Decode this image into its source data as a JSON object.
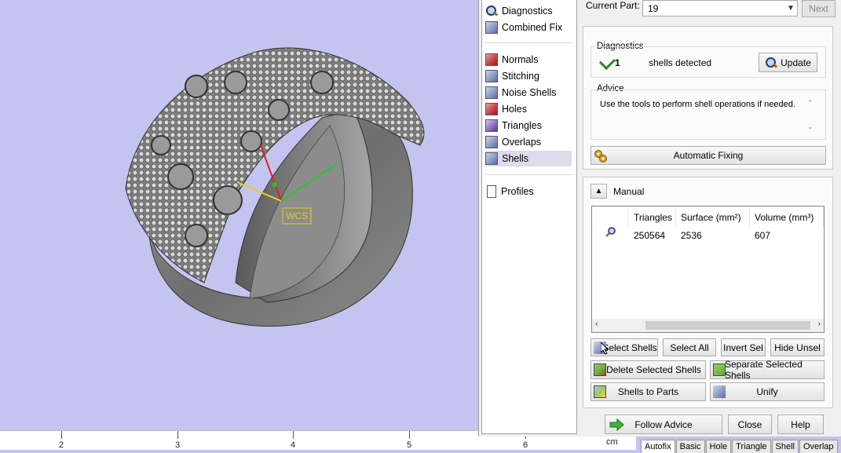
{
  "viewport": {
    "wcs_label": "WCS"
  },
  "ruler": {
    "ticks": [
      "2",
      "3",
      "4",
      "5",
      "6"
    ],
    "unit": "cm"
  },
  "nav": {
    "top": [
      {
        "label": "Diagnostics",
        "icon": "magnifier-icon"
      },
      {
        "label": "Combined Fix",
        "icon": "cube-icon"
      }
    ],
    "tools": [
      {
        "label": "Normals",
        "icon": "normals-icon"
      },
      {
        "label": "Stitching",
        "icon": "stitching-icon"
      },
      {
        "label": "Noise Shells",
        "icon": "noise-shells-icon"
      },
      {
        "label": "Holes",
        "icon": "holes-icon"
      },
      {
        "label": "Triangles",
        "icon": "triangles-icon"
      },
      {
        "label": "Overlaps",
        "icon": "overlaps-icon"
      },
      {
        "label": "Shells",
        "icon": "shells-icon",
        "active": true
      }
    ],
    "bottom": [
      {
        "label": "Profiles",
        "icon": "document-icon"
      }
    ]
  },
  "current_part": {
    "label": "Current Part:",
    "value": "19",
    "next_label": "Next"
  },
  "diagnostics": {
    "title": "Diagnostics",
    "count": "1",
    "text": "shells detected",
    "update_label": "Update"
  },
  "advice": {
    "title": "Advice",
    "text": "Use the tools to perform shell operations if needed.",
    "auto_fix_label": "Automatic Fixing"
  },
  "manual": {
    "title": "Manual",
    "columns": [
      "Triangles",
      "Surface (mm²)",
      "Volume (mm³)"
    ],
    "rows": [
      {
        "triangles": "250564",
        "surface": "2536",
        "volume": "607"
      }
    ]
  },
  "buttons": {
    "select_shells": "Select Shells",
    "select_all": "Select All",
    "invert_sel": "Invert Sel",
    "hide_unsel": "Hide Unsel",
    "delete_selected": "Delete Selected Shells",
    "separate_selected": "Separate Selected Shells",
    "shells_to_parts": "Shells to Parts",
    "unify": "Unify",
    "follow_advice": "Follow Advice",
    "close": "Close",
    "help": "Help"
  },
  "bottom_tabs": [
    "Autofix",
    "Basic",
    "Hole",
    "Triangle",
    "Shell",
    "Overlap"
  ],
  "colors": {
    "viewport_bg": "#c4c4f0",
    "accent_green": "#2a8a2a"
  }
}
